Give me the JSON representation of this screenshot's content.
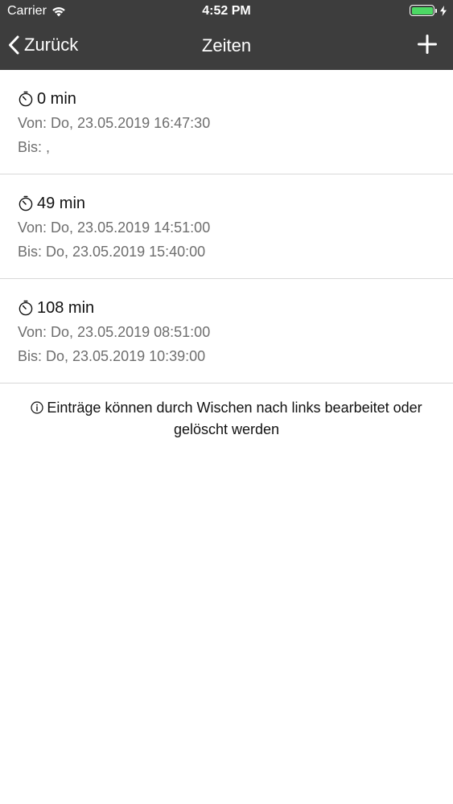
{
  "status_bar": {
    "carrier": "Carrier",
    "time": "4:52 PM",
    "battery_color": "#4cd964",
    "icons": [
      "wifi-icon",
      "battery-icon",
      "charging-bolt-icon"
    ]
  },
  "nav": {
    "back_label": "Zurück",
    "title": "Zeiten",
    "icons": [
      "chevron-left-icon",
      "plus-icon"
    ]
  },
  "entries": [
    {
      "duration": "0 min",
      "von": "Von: Do, 23.05.2019 16:47:30",
      "bis": "Bis: ,"
    },
    {
      "duration": "49 min",
      "von": "Von: Do, 23.05.2019 14:51:00",
      "bis": "Bis: Do, 23.05.2019 15:40:00"
    },
    {
      "duration": "108 min",
      "von": "Von: Do, 23.05.2019 08:51:00",
      "bis": "Bis: Do, 23.05.2019 10:39:00"
    }
  ],
  "hint": {
    "text": "Einträge können durch Wischen nach links bearbeitet oder gelöscht werden",
    "icon": "info-icon"
  }
}
